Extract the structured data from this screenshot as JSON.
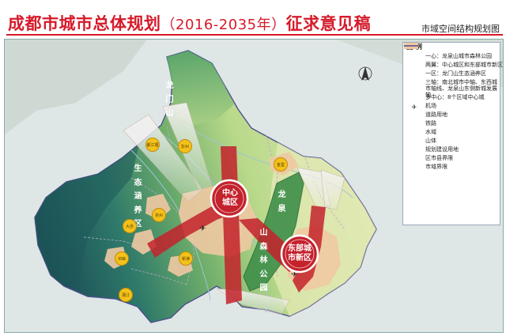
{
  "header": {
    "title_main": "成都市城市总体规划",
    "title_paren": "（2016-2035年）",
    "title_tail": "征求意见稿",
    "subtitle": "市域空间结构规划图"
  },
  "map": {
    "labels": {
      "longmen": [
        "龙",
        "门",
        "山",
        "生",
        "态",
        "涵",
        "养",
        "区"
      ],
      "longquan": [
        "龙",
        "泉",
        "山",
        "森",
        "林",
        "公",
        "园"
      ],
      "center": [
        "中心",
        "城区"
      ],
      "east": [
        "东部城",
        "市新区"
      ]
    },
    "subcenters": [
      "都江堰",
      "彭州",
      "大邑",
      "崇州",
      "邛崃",
      "新津",
      "蒲江",
      "金堂"
    ]
  },
  "legend": {
    "title": "图 例",
    "items": [
      {
        "icon": "green-line",
        "label": "一心：龙泉山城市森林公园"
      },
      {
        "icon": "red-dot",
        "label": "两翼：中心城区和东部城市新区"
      },
      {
        "icon": "teal-fill",
        "label": "一区：龙门山生态涵养区"
      },
      {
        "icon": "red-cross",
        "label": "三轴：南北城市中轴、东西城市轴线、龙泉山东侧新城发展轴"
      },
      {
        "icon": "yellow-dot",
        "label": "多中心：8个区域中心城"
      },
      {
        "icon": "airplane-icon",
        "label": "机场"
      },
      {
        "icon": "road-line",
        "label": "道路用地"
      },
      {
        "icon": "rail-line",
        "label": "铁路"
      },
      {
        "icon": "water-line",
        "label": "水域"
      },
      {
        "icon": "mountain-fill",
        "label": "山体"
      },
      {
        "icon": "build-fill",
        "label": "规划建设用地"
      },
      {
        "icon": "county-boundary",
        "label": "区市县界限"
      },
      {
        "icon": "city-boundary",
        "label": "市域界限"
      }
    ]
  },
  "colors": {
    "title_red": "#d61a2a",
    "mountain_teal": "#1e5a5a",
    "forest_green": "#6aa84f",
    "axis_red": "#c4222c",
    "subcenter_yellow": "#f3c21b"
  }
}
